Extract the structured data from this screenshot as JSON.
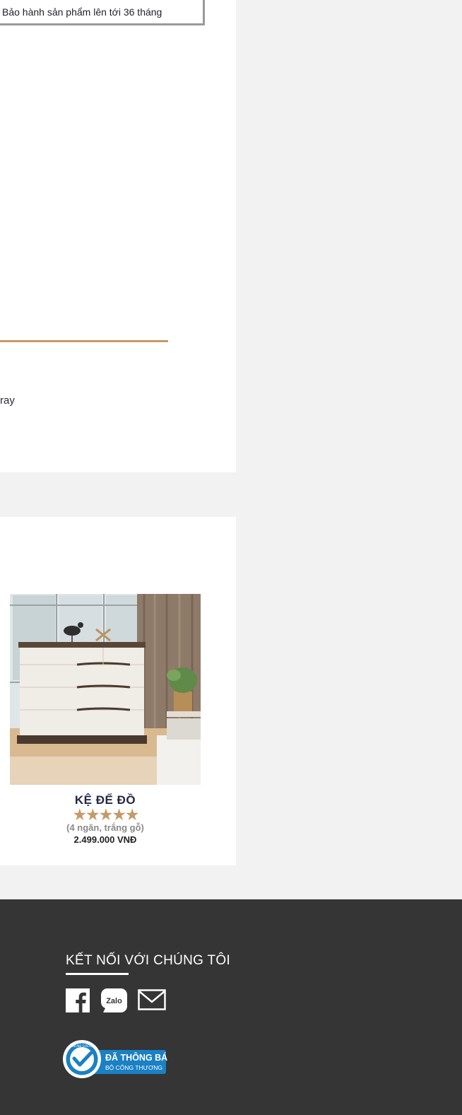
{
  "warranty": {
    "text": "Bảo hành sản phẩm lên tới 36 tháng"
  },
  "details": {
    "partial_text": "ray"
  },
  "product": {
    "name": "KỆ ĐỂ ĐỒ",
    "stars": "★★★★★",
    "rating_value": 5,
    "variant": "(4 ngăn, trắng gỗ)",
    "price": "2.499.000 VNĐ"
  },
  "footer": {
    "connect_title": "KẾT NỐI VỚI CHÚNG TÔI",
    "social": [
      {
        "icon": "facebook-icon"
      },
      {
        "icon": "zalo-icon",
        "label": "Zalo"
      },
      {
        "icon": "mail-icon"
      }
    ],
    "badge": {
      "title": "ĐÃ THÔNG BÁO",
      "subtitle": "BỘ CÔNG THƯƠNG",
      "seal_text": "ONLINE.GOV.VN",
      "color": "#1b80c4"
    }
  },
  "colors": {
    "accent_gold": "#c49a66",
    "navy": "#232845",
    "footer_bg": "#353535",
    "page_bg": "#f2f2f2"
  }
}
